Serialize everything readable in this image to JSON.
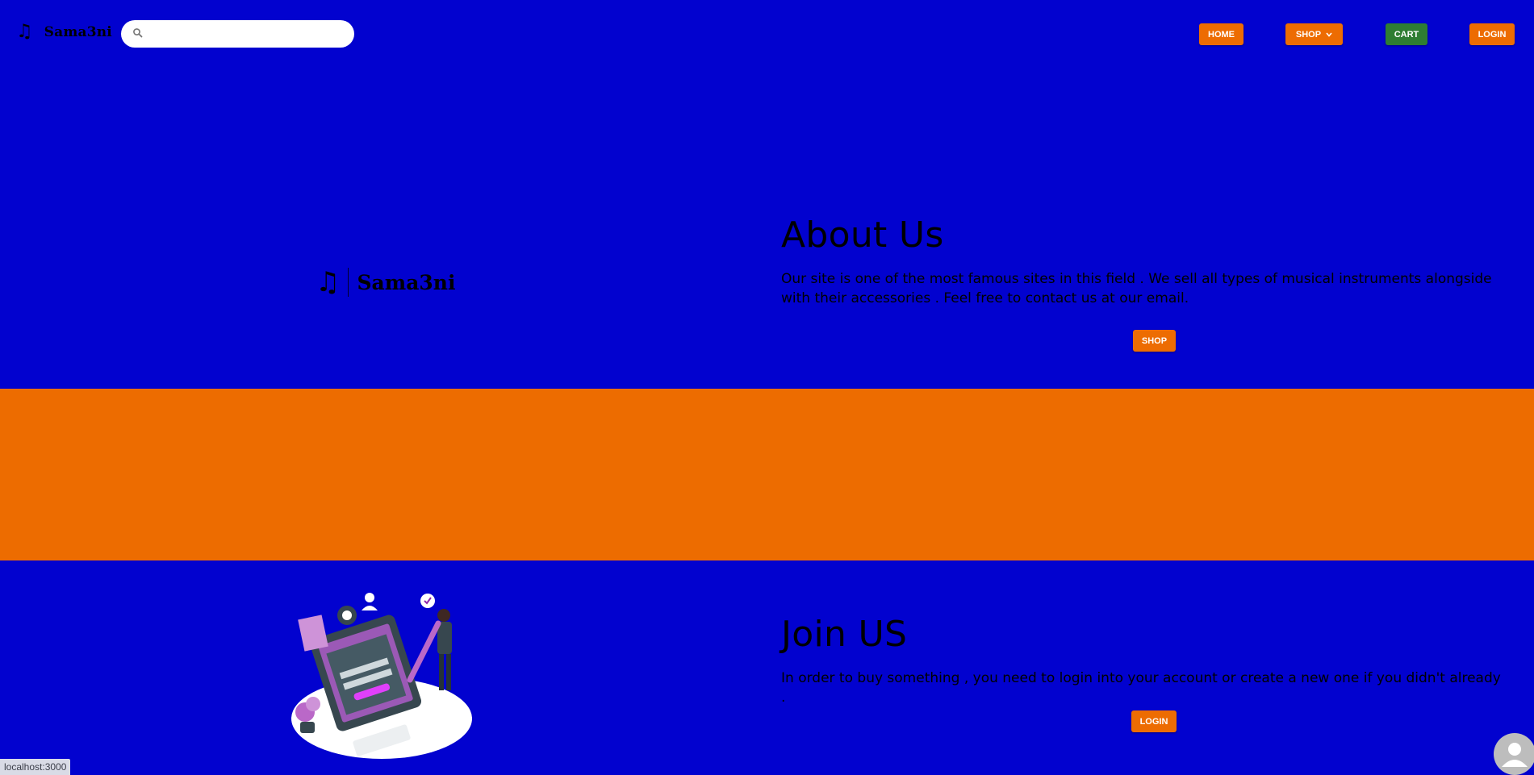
{
  "header": {
    "brand_icon": "music-note-icon",
    "brand_name": "Sama3ni",
    "search": {
      "placeholder": "",
      "value": "",
      "icon": "search-icon"
    },
    "nav": {
      "home": "HOME",
      "shop": "SHOP",
      "cart": "CART",
      "login": "LOGIN"
    }
  },
  "about": {
    "logo_name": "Sama3ni",
    "title": "About Us",
    "text": "Our site is one of the most famous sites in this field . We sell all types of musical instruments alongside with their accessories . Feel free to contact us at our email.",
    "button": "SHOP"
  },
  "join": {
    "illustration": "sign-up-illustration",
    "title": "Join US",
    "text": "In order to buy something , you need to login into your account or create a new one if you didn't already .",
    "button": "LOGIN"
  },
  "status_url": "localhost:3000",
  "colors": {
    "background": "#0202cf",
    "accent_orange": "#ed6c02",
    "cart_green": "#2e7d32",
    "band_orange": "#ed6c00"
  }
}
